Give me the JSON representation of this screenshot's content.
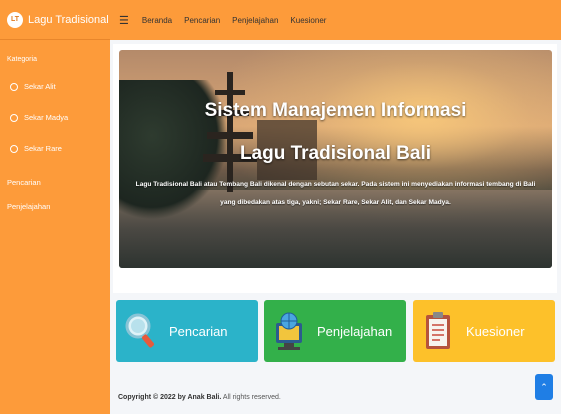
{
  "brand": {
    "logo": "LT",
    "name": "Lagu Tradisional"
  },
  "sidebar": {
    "header": "Kategoria",
    "items": [
      {
        "label": "Sekar Alit",
        "icon": "circle-icon"
      },
      {
        "label": "Sekar Madya",
        "icon": "circle-icon"
      },
      {
        "label": "Sekar Rare",
        "icon": "circle-icon"
      }
    ],
    "links": [
      "Pencarian",
      "Penjelajahan"
    ]
  },
  "topbar": {
    "menu_icon": "hamburger-icon",
    "links": [
      "Beranda",
      "Pencarian",
      "Penjelajahan",
      "Kuesioner"
    ]
  },
  "hero": {
    "title_line1": "Sistem Manajemen Informasi",
    "title_line2": "Lagu Tradisional Bali",
    "desc_line1": "Lagu Tradisional Bali atau Tembang Bali dikenal dengan sebutan sekar. Pada sistem ini menyediakan informasi tembang di Bali",
    "desc_line2": "yang dibedakan atas tiga, yakni; Sekar Rare, Sekar Alit, dan Sekar Madya."
  },
  "tiles": [
    {
      "label": "Pencarian",
      "icon": "magnifier-icon",
      "color": "#2bb3c9"
    },
    {
      "label": "Penjelajahan",
      "icon": "globe-computer-icon",
      "color": "#33b04a"
    },
    {
      "label": "Kuesioner",
      "icon": "clipboard-icon",
      "color": "#fdc12a"
    }
  ],
  "footer": {
    "copyright": "Copyright © 2022 by Anak Bali.",
    "rights": "All rights reserved."
  },
  "back_to_top_icon": "chevron-up-icon"
}
